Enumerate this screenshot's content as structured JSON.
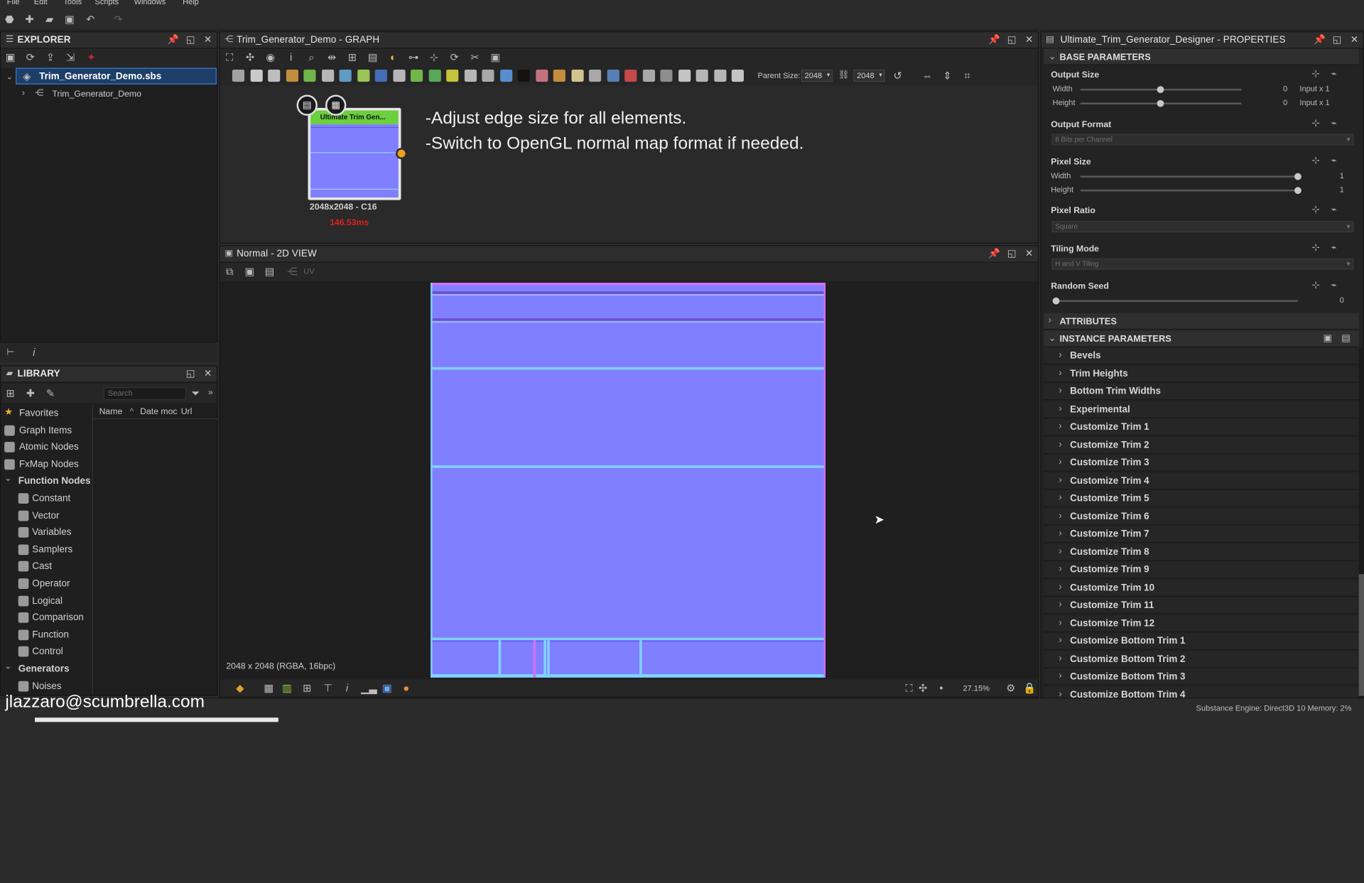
{
  "menu": [
    "File",
    "Edit",
    "Tools",
    "Scripts",
    "Windows",
    "Help"
  ],
  "explorer": {
    "title": "EXPLORER",
    "file": "Trim_Generator_Demo.sbs",
    "graph": "Trim_Generator_Demo"
  },
  "library": {
    "title": "LIBRARY",
    "search_placeholder": "Search",
    "columns": [
      "Name",
      "Date moc",
      "Url"
    ],
    "items": [
      {
        "label": "Favorites",
        "icon": "star-icon"
      },
      {
        "label": "Graph Items",
        "icon": "graph-items-icon"
      },
      {
        "label": "Atomic Nodes",
        "icon": "atomic-nodes-icon"
      },
      {
        "label": "FxMap Nodes",
        "icon": "fxmap-icon"
      },
      {
        "label": "Function Nodes",
        "icon": "function-icon",
        "section": true
      },
      {
        "label": "Constant",
        "icon": "node-icon"
      },
      {
        "label": "Vector",
        "icon": "node-icon"
      },
      {
        "label": "Variables",
        "icon": "node-icon"
      },
      {
        "label": "Samplers",
        "icon": "node-icon"
      },
      {
        "label": "Cast",
        "icon": "node-icon"
      },
      {
        "label": "Operator",
        "icon": "node-icon"
      },
      {
        "label": "Logical",
        "icon": "node-icon"
      },
      {
        "label": "Comparison",
        "icon": "node-icon"
      },
      {
        "label": "Function",
        "icon": "node-icon"
      },
      {
        "label": "Control",
        "icon": "node-icon"
      },
      {
        "label": "Generators",
        "icon": "generators-icon",
        "section": true
      },
      {
        "label": "Noises",
        "icon": "node-icon"
      }
    ]
  },
  "graph": {
    "title": "Trim_Generator_Demo - GRAPH",
    "parent_size_label": "Parent Size:",
    "parent_w": "2048",
    "parent_h": "2048",
    "node": {
      "title": "Ultimate Trim Gen...",
      "size": "2048x2048 - C16",
      "time": "146.53ms"
    },
    "comment_lines": [
      "-Adjust edge size for all elements.",
      "-Switch to OpenGL normal map format if needed."
    ]
  },
  "view2d": {
    "title": "Normal - 2D VIEW",
    "uv": "UV",
    "status": "2048 x 2048 (RGBA, 16bpc)",
    "zoom": "27.15%"
  },
  "properties": {
    "title": "Ultimate_Trim_Generator_Designer - PROPERTIES",
    "base": "BASE PARAMETERS",
    "output_size": {
      "label": "Output Size",
      "width": "Width",
      "height": "Height",
      "w_val": "0",
      "h_val": "0",
      "w_mode": "Input x 1",
      "h_mode": "Input x 1"
    },
    "output_format": {
      "label": "Output Format",
      "value": "8 Bits per Channel"
    },
    "pixel_size": {
      "label": "Pixel Size",
      "width": "Width",
      "height": "Height",
      "w_val": "1",
      "h_val": "1"
    },
    "pixel_ratio": {
      "label": "Pixel Ratio",
      "value": "Square"
    },
    "tiling": {
      "label": "Tiling Mode",
      "value": "H and V Tiling"
    },
    "seed": {
      "label": "Random Seed",
      "value": "0"
    },
    "attributes": "ATTRIBUTES",
    "instance": "INSTANCE PARAMETERS",
    "groups": [
      "Bevels",
      "Trim Heights",
      "Bottom Trim Widths",
      "Experimental",
      "Customize Trim 1",
      "Customize Trim 2",
      "Customize Trim 3",
      "Customize Trim 4",
      "Customize Trim 5",
      "Customize Trim 6",
      "Customize Trim 7",
      "Customize Trim 8",
      "Customize Trim 9",
      "Customize Trim 10",
      "Customize Trim 11",
      "Customize Trim 12",
      "Customize Bottom Trim 1",
      "Customize Bottom Trim 2",
      "Customize Bottom Trim 3",
      "Customize Bottom Trim 4"
    ]
  },
  "statusbar": {
    "engine": "Substance Engine: Direct3D 10  Memory: 2%"
  },
  "watermark": "jlazzaro@scumbrella.com",
  "colors": {
    "accent": "#3a7bd5",
    "normal_map": "#7f7fff",
    "node_header": "#6ccf3f",
    "time": "#e02020"
  }
}
